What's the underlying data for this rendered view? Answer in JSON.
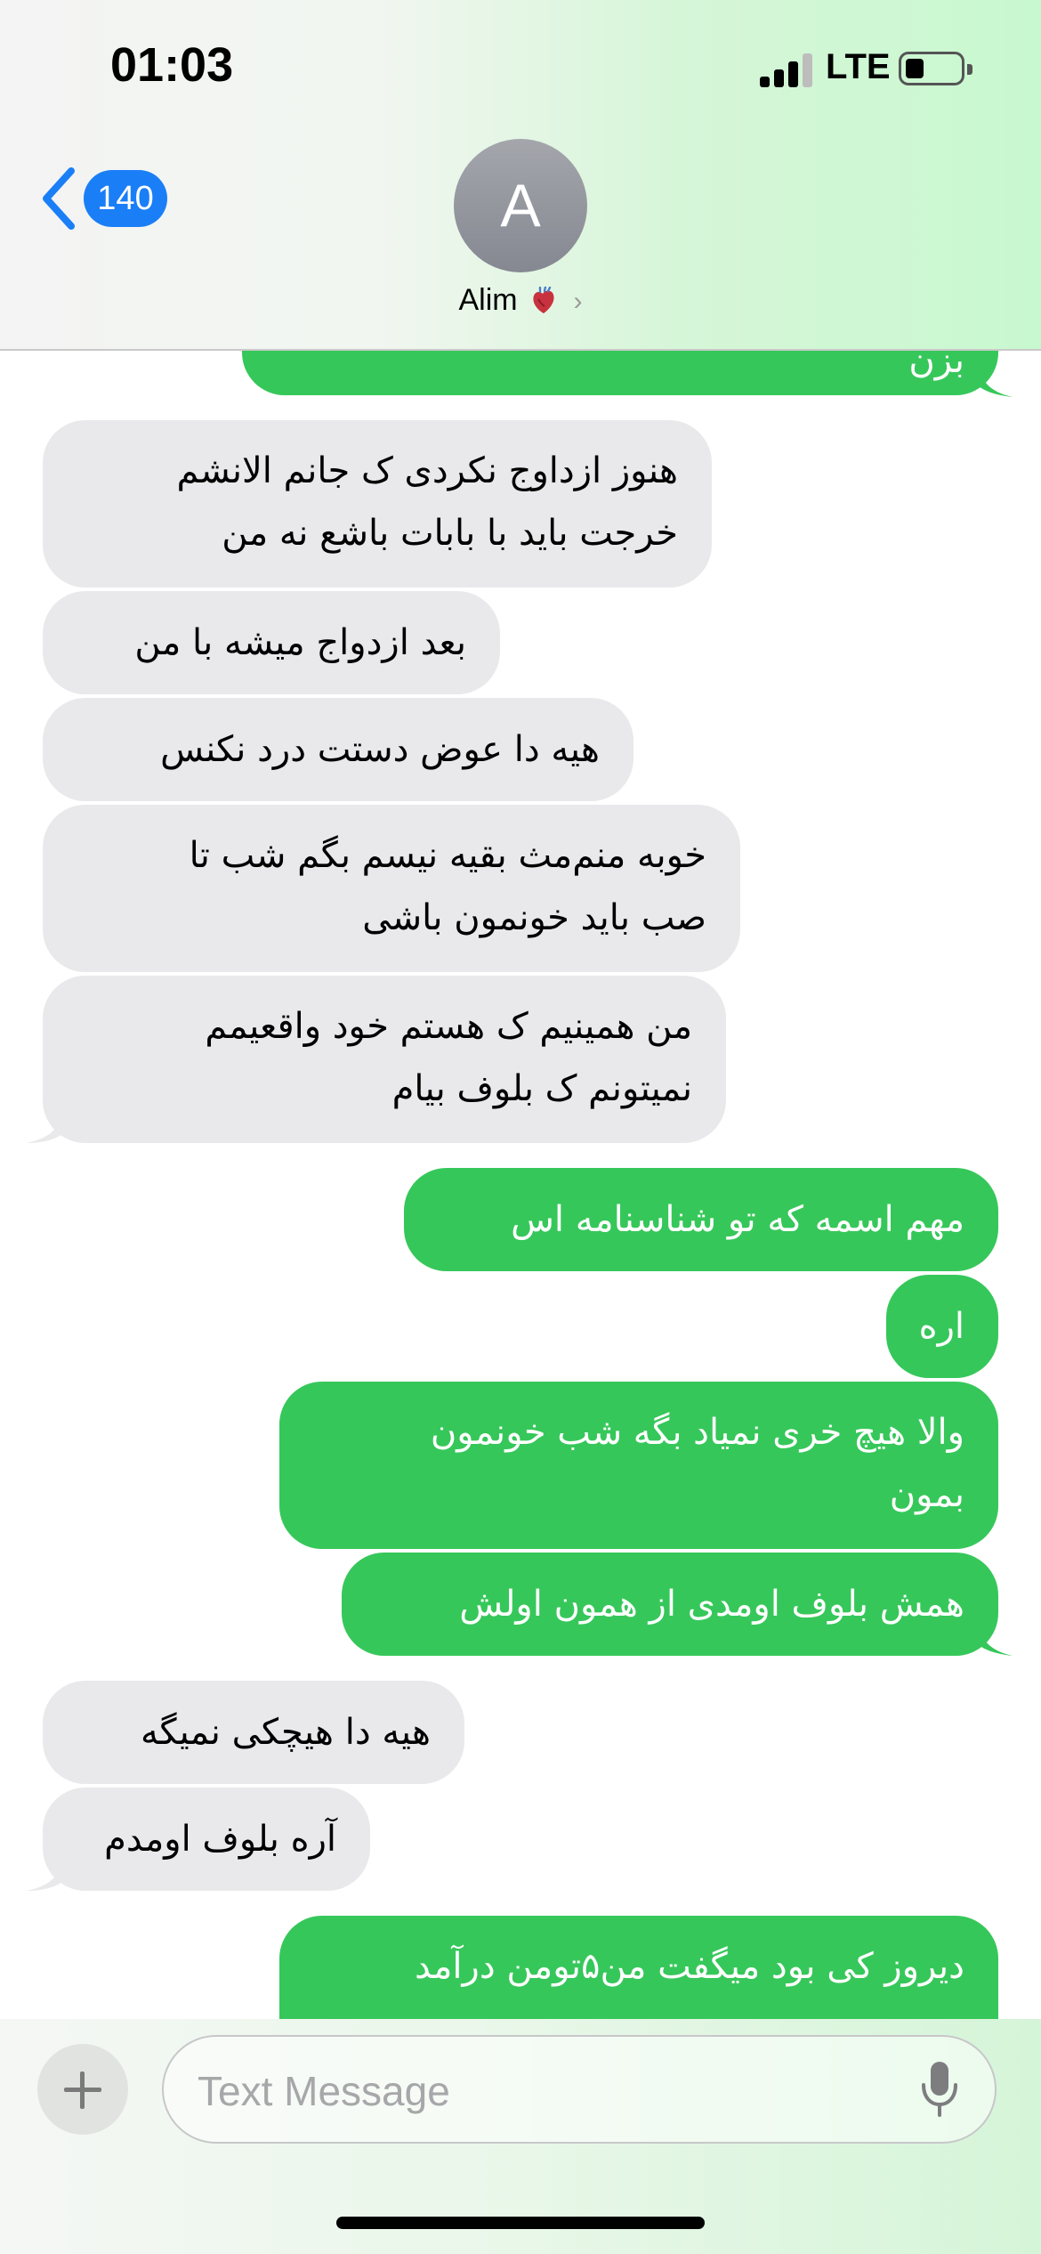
{
  "status_bar": {
    "time": "01:03",
    "network": "LTE"
  },
  "nav": {
    "back_count": "140",
    "avatar_initial": "A",
    "contact_name": "Alim",
    "contact_emoji": "anatomical-heart-icon"
  },
  "messages": [
    {
      "dir": "out",
      "text": "بزن"
    },
    {
      "dir": "in",
      "lines": [
        "هنوز ازداوج نکردی ک جانم الانشم",
        "خرجت باید با بابات باشع نه من"
      ]
    },
    {
      "dir": "in",
      "lines": [
        "بعد ازدواج میشه با من"
      ]
    },
    {
      "dir": "in",
      "lines": [
        "هیه دا عوض دستت درد نکنس"
      ]
    },
    {
      "dir": "in",
      "lines": [
        "خوبه منم‌مث بقیه نیسم بگم شب تا",
        "صب باید خونمون باشی"
      ]
    },
    {
      "dir": "in",
      "lines": [
        "من همینیم ک هستم خود واقعیمم",
        "نمیتونم ک بلوف بیام"
      ]
    },
    {
      "dir": "out",
      "lines": [
        "مهم اسمه که تو شناسنامه اس"
      ]
    },
    {
      "dir": "out",
      "lines": [
        "اره"
      ]
    },
    {
      "dir": "out",
      "lines": [
        "والا هیچ خری نمیاد بگه شب خونمون",
        "بمون"
      ]
    },
    {
      "dir": "out",
      "lines": [
        "همش بلوف اومدی از همون اولش"
      ]
    },
    {
      "dir": "in",
      "lines": [
        "هیه دا هیچکی نمیگه"
      ]
    },
    {
      "dir": "in",
      "lines": [
        "آره بلوف اومدم"
      ]
    },
    {
      "dir": "out",
      "lines": [
        "دیروز کی بود میگفت من۵تومن درآمد"
      ]
    }
  ],
  "composer": {
    "placeholder": "Text Message"
  },
  "colors": {
    "sent": "#36c75a",
    "received": "#e9e9eb",
    "accent": "#1a7ef7"
  }
}
